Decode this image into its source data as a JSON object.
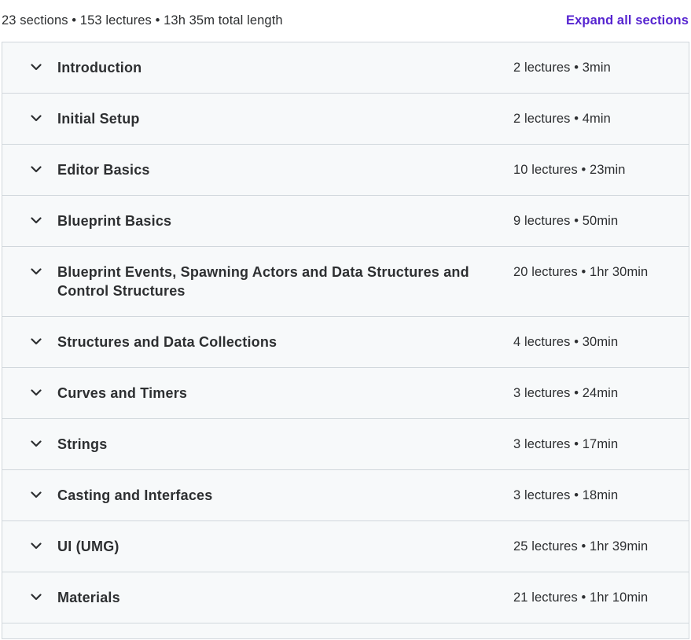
{
  "header": {
    "summary": "23 sections • 153 lectures • 13h 35m total length",
    "expand_all_label": "Expand all sections"
  },
  "sections": [
    {
      "title": "Introduction",
      "meta": "2 lectures • 3min"
    },
    {
      "title": "Initial Setup",
      "meta": "2 lectures • 4min"
    },
    {
      "title": "Editor Basics",
      "meta": "10 lectures • 23min"
    },
    {
      "title": "Blueprint Basics",
      "meta": "9 lectures • 50min"
    },
    {
      "title": "Blueprint Events, Spawning Actors and Data Structures and Control Structures",
      "meta": "20 lectures • 1hr 30min"
    },
    {
      "title": "Structures and Data Collections",
      "meta": "4 lectures • 30min"
    },
    {
      "title": "Curves and Timers",
      "meta": "3 lectures • 24min"
    },
    {
      "title": "Strings",
      "meta": "3 lectures • 17min"
    },
    {
      "title": "Casting and Interfaces",
      "meta": "3 lectures • 18min"
    },
    {
      "title": "UI (UMG)",
      "meta": "25 lectures • 1hr 39min"
    },
    {
      "title": "Materials",
      "meta": "21 lectures • 1hr 10min"
    }
  ],
  "icons": {
    "section_toggle": "chevron-down-icon"
  },
  "colors": {
    "accent": "#5624d0",
    "text": "#2d2f31",
    "section_bg": "#f7f9fa",
    "border": "#d1d7dc"
  }
}
